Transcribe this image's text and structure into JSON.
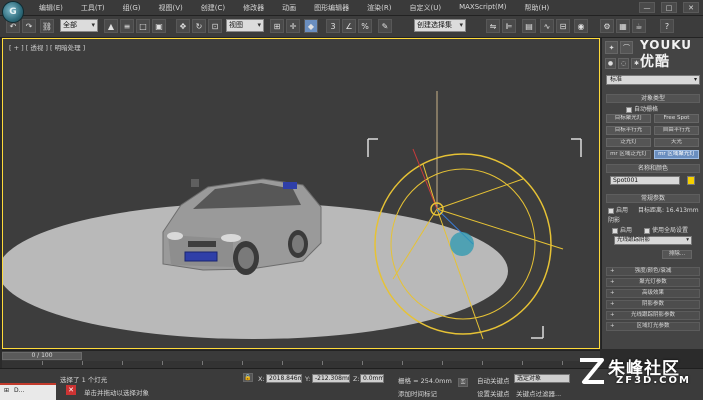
{
  "app": {
    "logo_text": "G"
  },
  "menu": {
    "items": [
      "编辑(E)",
      "工具(T)",
      "组(G)",
      "视图(V)",
      "创建(C)",
      "修改器",
      "动画",
      "图形编辑器",
      "渲染(R)",
      "自定义(U)",
      "MAXScript(M)",
      "帮助(H)"
    ],
    "window_controls": [
      "—",
      "□",
      "✕"
    ]
  },
  "toolbar": {
    "selection_filter": "全部",
    "reference_coord": "视图",
    "named_selection": "创建选择集",
    "snap_label": "3"
  },
  "viewport": {
    "label": "[ + ] [ 透视 ] [ 明暗处理 ]"
  },
  "command_panel": {
    "watermark_line1": "YOUKU",
    "watermark_line2": "优酷",
    "category": "标准",
    "object_type_title": "对象类型",
    "autogrid": "自动栅格",
    "light_buttons": [
      {
        "label": "目标聚光灯",
        "active": false
      },
      {
        "label": "Free Spot",
        "active": false
      },
      {
        "label": "目标平行光",
        "active": false
      },
      {
        "label": "自由平行光",
        "active": false
      },
      {
        "label": "泛光灯",
        "active": false
      },
      {
        "label": "天光",
        "active": false
      },
      {
        "label": "mr 区域泛光灯",
        "active": false
      },
      {
        "label": "mr 区域聚光灯",
        "active": true
      }
    ],
    "name_color_title": "名称和颜色",
    "name_value": "Spot001",
    "general_title": "常规参数",
    "light_type_on": "启用",
    "target_dist": "目标距离: 16.413mm",
    "shadows_label": "阴影",
    "shadows_on": "启用",
    "use_global": "使用全局设置",
    "shadow_type": "光线跟踪阴影",
    "exclude_button": "排除...",
    "rollups": [
      "强度/颜色/衰减",
      "聚光灯参数",
      "高级效果",
      "阴影参数",
      "光线跟踪阴影参数",
      "区域灯光参数"
    ]
  },
  "timeline": {
    "frame_display": "0 / 100"
  },
  "status": {
    "selected_text": "选择了 1 个灯光",
    "prompt_text": "单击并拖动以选择对象",
    "x_label": "X:",
    "x_value": "2018.846m",
    "y_label": "Y:",
    "y_value": "-212.308mm",
    "z_label": "Z:",
    "z_value": "0.0mm",
    "grid_text": "栅格 = 254.0mm",
    "add_time_tag": "添加时间标记",
    "auto_key": "自动关键点",
    "selected_object": "选定对象",
    "set_key": "设置关键点",
    "key_filters": "关键点过滤器..."
  },
  "taskbar": {
    "item_label": "D..."
  },
  "site_logo": {
    "title": "朱峰社区",
    "subtitle": "ZF3D.COM"
  },
  "colors": {
    "viewport_bg": "#3d3d3d",
    "ground": "#b9b9b9",
    "light_yellow": "#e6c235",
    "active_button": "#6a8ebf",
    "selection_border": "#ffdb3a"
  }
}
